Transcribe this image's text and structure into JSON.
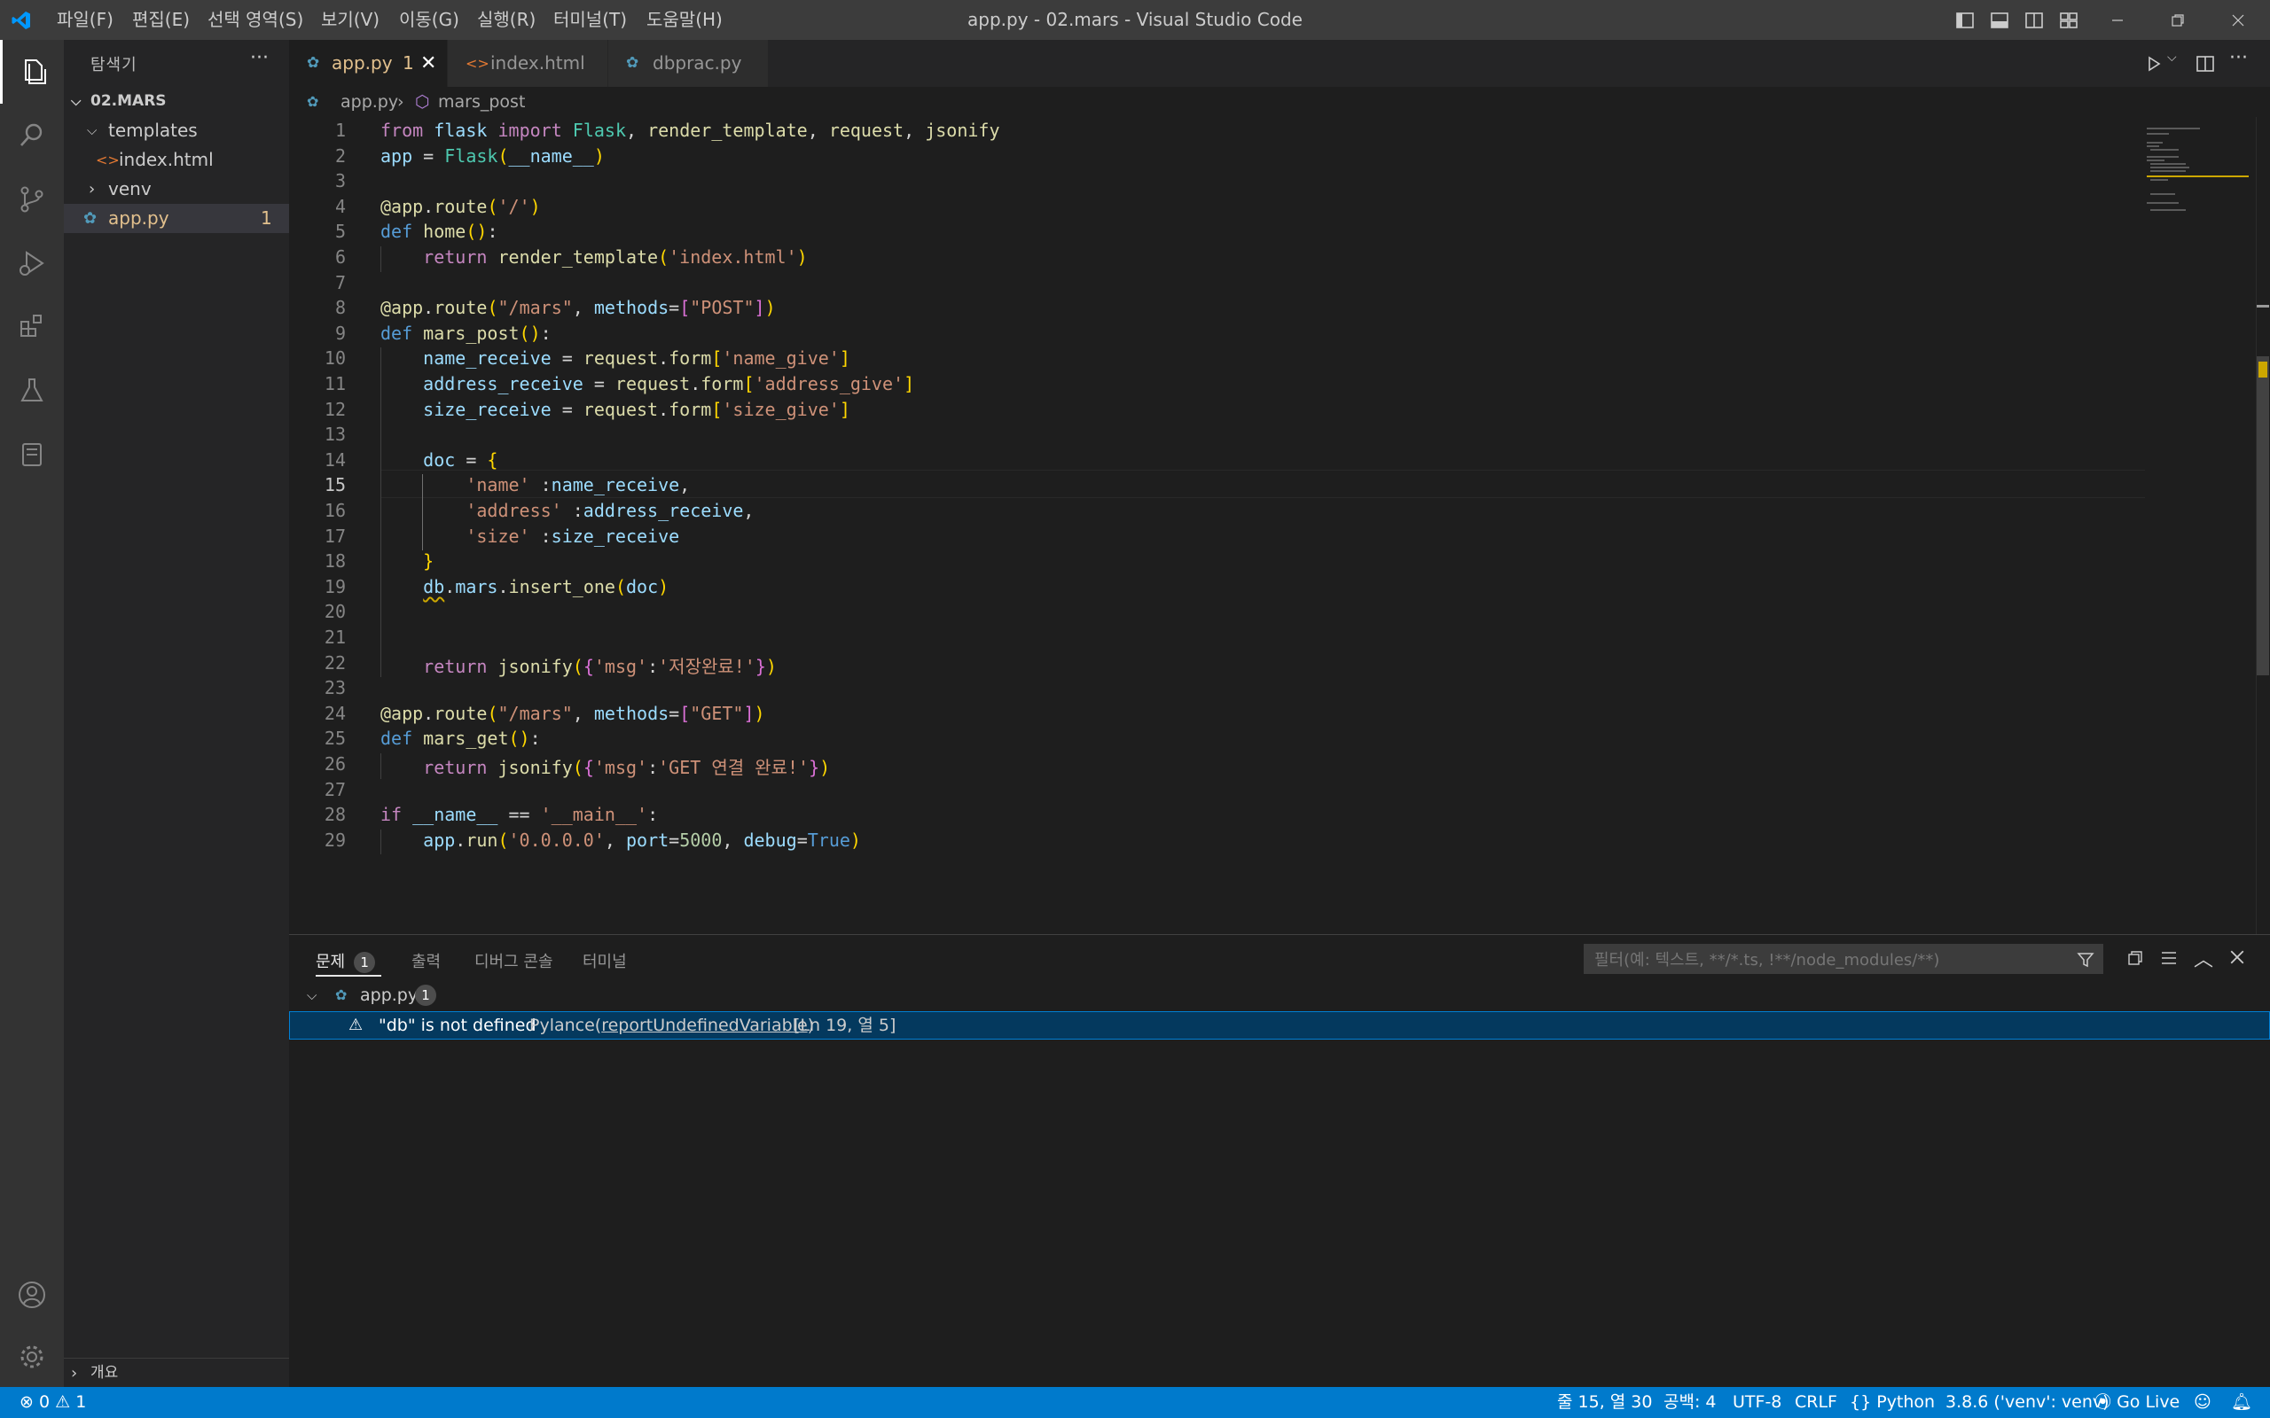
{
  "window": {
    "title": "app.py - 02.mars - Visual Studio Code",
    "menu": [
      "파일(F)",
      "편집(E)",
      "선택 영역(S)",
      "보기(V)",
      "이동(G)",
      "실행(R)",
      "터미널(T)",
      "도움말(H)"
    ]
  },
  "sidebar": {
    "header": "탐색기",
    "folder": "02.MARS",
    "items": [
      {
        "label": "templates"
      },
      {
        "label": "index.html"
      },
      {
        "label": "venv"
      },
      {
        "label": "app.py",
        "badge": "1"
      }
    ],
    "outline": "개요"
  },
  "tabs": [
    {
      "label": "app.py",
      "badge": "1"
    },
    {
      "label": "index.html"
    },
    {
      "label": "dbprac.py"
    }
  ],
  "breadcrumb": {
    "file": "app.py",
    "symbol": "mars_post"
  },
  "editor": {
    "current_line": 15,
    "lines": [
      "from flask import Flask, render_template, request, jsonify",
      "app = Flask(__name__)",
      "",
      "@app.route('/')",
      "def home():",
      "    return render_template('index.html')",
      "",
      "@app.route(\"/mars\", methods=[\"POST\"])",
      "def mars_post():",
      "    name_receive = request.form['name_give']",
      "    address_receive = request.form['address_give']",
      "    size_receive = request.form['size_give']",
      "",
      "    doc = {",
      "        'name' :name_receive,",
      "        'address' :address_receive,",
      "        'size' :size_receive",
      "    }",
      "    db.mars.insert_one(doc)",
      "",
      "",
      "    return jsonify({'msg':'저장완료!'})",
      "",
      "@app.route(\"/mars\", methods=[\"GET\"])",
      "def mars_get():",
      "    return jsonify({'msg':'GET 연결 완료!'})",
      "",
      "if __name__ == '__main__':",
      "    app.run('0.0.0.0', port=5000, debug=True)"
    ]
  },
  "panel": {
    "tabs": [
      {
        "label": "문제",
        "badge": "1"
      },
      {
        "label": "출력"
      },
      {
        "label": "디버그 콘솔"
      },
      {
        "label": "터미널"
      }
    ],
    "filter_placeholder": "필터(예: 텍스트, **/*.ts, !**/node_modules/**)",
    "problem_file": "app.py",
    "problem_count": "1",
    "problem": {
      "message": "\"db\" is not defined",
      "source": "Pylance(",
      "code": "reportUndefinedVariable",
      "source_end": ")",
      "location": "[Ln 19, 열 5]"
    }
  },
  "status": {
    "errors": "0",
    "warnings": "1",
    "position": "줄 15, 열 30",
    "spaces": "공백: 4",
    "encoding": "UTF-8",
    "eol": "CRLF",
    "language": "Python",
    "interpreter": "3.8.6 ('venv': venv)",
    "golive": "Go Live"
  },
  "colors": {
    "accent": "#007acc",
    "warning": "#cca700",
    "modified": "#e2c08d"
  }
}
